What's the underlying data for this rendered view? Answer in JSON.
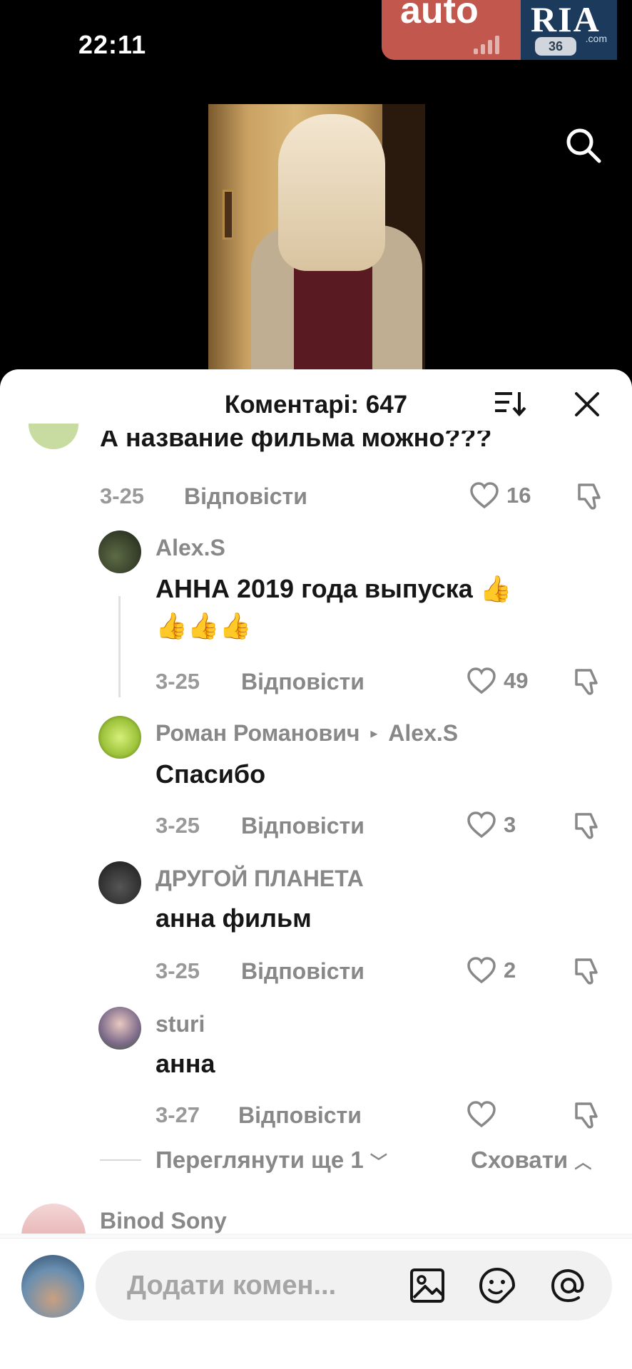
{
  "status": {
    "time": "22:11",
    "battery": "36"
  },
  "watermark": {
    "auto": "auto",
    "ria": "RIA",
    "com": ".com"
  },
  "comments_panel": {
    "title": "Коментарі: 647",
    "comments": [
      {
        "text": "А название фильма можно???",
        "date": "3-25",
        "reply_label": "Відповісти",
        "likes": "16"
      },
      {
        "user": "Alex.S",
        "text_line1": "АННА 2019 года выпуска",
        "text_line2": "",
        "date": "3-25",
        "reply_label": "Відповісти",
        "likes": "49"
      },
      {
        "user": "Роман Романович",
        "reply_to": "Alex.S",
        "text": "Спасибо",
        "date": "3-25",
        "reply_label": "Відповісти",
        "likes": "3"
      },
      {
        "user": "ДРУГОЙ ПЛАНЕТА",
        "text": "анна фильм",
        "date": "3-25",
        "reply_label": "Відповісти",
        "likes": "2"
      },
      {
        "user": "sturi",
        "text": "анна",
        "date": "3-27",
        "reply_label": "Відповісти",
        "likes": ""
      }
    ],
    "view_more": "Переглянути ще 1",
    "hide": "Сховати",
    "next_user": "Binod Sony"
  },
  "input": {
    "placeholder": "Додати комен..."
  },
  "icons": {
    "search": "search-icon",
    "sort": "sort-icon",
    "close": "close-icon",
    "heart": "heart-icon",
    "dislike": "dislike-icon",
    "image": "image-icon",
    "emoji": "emoji-icon",
    "mention": "mention-icon",
    "thumbs_up": "thumbs-up-emoji"
  },
  "colors": {
    "sheet_bg": "#ffffff",
    "secondary_text": "#888888",
    "primary_text": "#161616",
    "watermark_red": "#c2574e",
    "watermark_blue": "#1b3a5c"
  }
}
